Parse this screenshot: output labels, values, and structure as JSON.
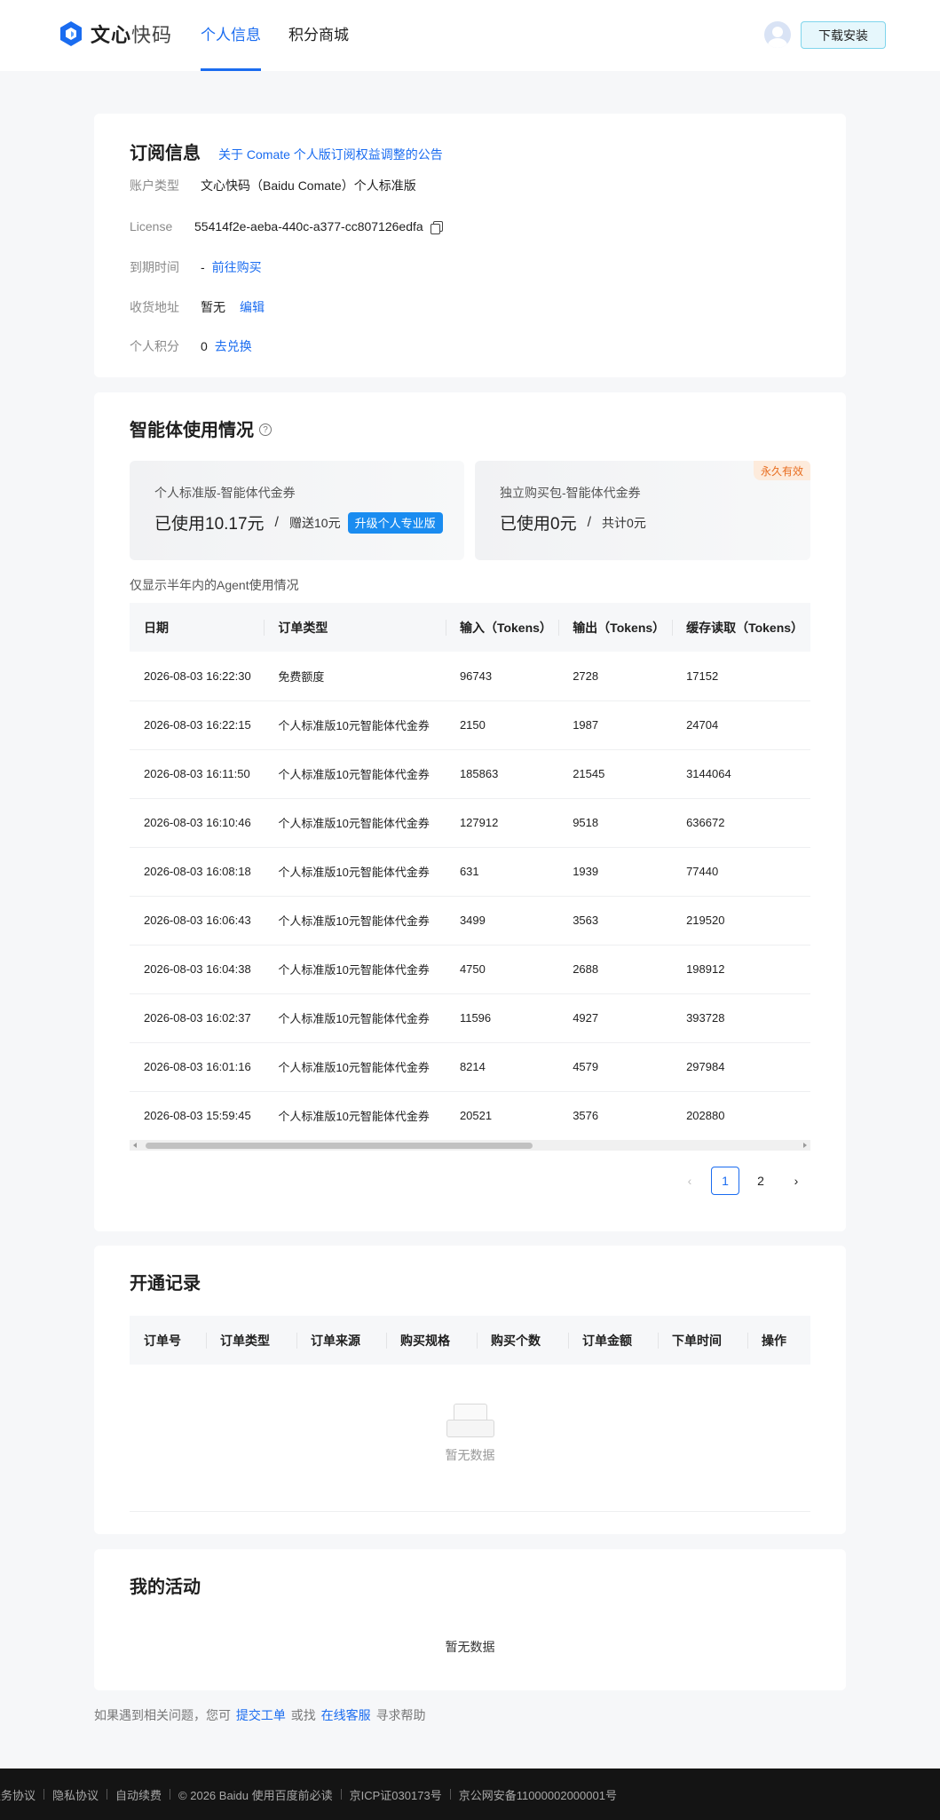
{
  "header": {
    "logo_brand": "文心",
    "logo_sub": "快码",
    "nav": [
      "个人信息",
      "积分商城"
    ],
    "download_label": "下载安装"
  },
  "subscription": {
    "title": "订阅信息",
    "announcement": "关于 Comate 个人版订阅权益调整的公告",
    "account_type_label": "账户类型",
    "account_type_value": "文心快码（Baidu Comate）个人标准版",
    "license_label": "License",
    "license_value": "55414f2e-aeba-440c-a377-cc807126edfa",
    "expire_label": "到期时间",
    "expire_value": "-",
    "expire_link": "前往购买",
    "address_label": "收货地址",
    "address_value": "暂无",
    "address_link": "编辑",
    "points_label": "个人积分",
    "points_value": "0",
    "points_link": "去兑换"
  },
  "agent": {
    "title": "智能体使用情况",
    "help_glyph": "?",
    "voucher1": {
      "title": "个人标准版-智能体代金券",
      "used": "已使用10.17元",
      "slash": "/",
      "gift": "赠送10元",
      "upgrade": "升级个人专业版"
    },
    "voucher2": {
      "title": "独立购买包-智能体代金券",
      "used": "已使用0元",
      "slash": "/",
      "total": "共计0元",
      "tag": "永久有效"
    },
    "note": "仅显示半年内的Agent使用情况",
    "columns": [
      "日期",
      "订单类型",
      "输入（Tokens）",
      "输出（Tokens）",
      "缓存读取（Tokens）"
    ],
    "rows": [
      [
        "2026-08-03 16:22:30",
        "免费额度",
        "96743",
        "2728",
        "17152"
      ],
      [
        "2026-08-03 16:22:15",
        "个人标准版10元智能体代金券",
        "2150",
        "1987",
        "24704"
      ],
      [
        "2026-08-03 16:11:50",
        "个人标准版10元智能体代金券",
        "185863",
        "21545",
        "3144064"
      ],
      [
        "2026-08-03 16:10:46",
        "个人标准版10元智能体代金券",
        "127912",
        "9518",
        "636672"
      ],
      [
        "2026-08-03 16:08:18",
        "个人标准版10元智能体代金券",
        "631",
        "1939",
        "77440"
      ],
      [
        "2026-08-03 16:06:43",
        "个人标准版10元智能体代金券",
        "3499",
        "3563",
        "219520"
      ],
      [
        "2026-08-03 16:04:38",
        "个人标准版10元智能体代金券",
        "4750",
        "2688",
        "198912"
      ],
      [
        "2026-08-03 16:02:37",
        "个人标准版10元智能体代金券",
        "11596",
        "4927",
        "393728"
      ],
      [
        "2026-08-03 16:01:16",
        "个人标准版10元智能体代金券",
        "8214",
        "4579",
        "297984"
      ],
      [
        "2026-08-03 15:59:45",
        "个人标准版10元智能体代金券",
        "20521",
        "3576",
        "202880"
      ]
    ],
    "pager": {
      "prev": "‹",
      "pages": [
        "1",
        "2"
      ],
      "current": "1",
      "next": "›"
    }
  },
  "open_records": {
    "title": "开通记录",
    "columns": [
      "订单号",
      "订单类型",
      "订单来源",
      "购买规格",
      "购买个数",
      "订单金额",
      "下单时间",
      "操作"
    ],
    "empty": "暂无数据"
  },
  "activities": {
    "title": "我的活动",
    "empty": "暂无数据"
  },
  "help": {
    "prefix": "如果遇到相关问题，您可",
    "ticket": "提交工单",
    "or": "或找",
    "service": "在线客服",
    "suffix": "寻求帮助"
  },
  "footer": [
    "服务协议",
    "隐私协议",
    "自动续费",
    "© 2026 Baidu 使用百度前必读",
    "京ICP证030173号",
    "京公网安备11000002000001号"
  ],
  "colors": {
    "accent": "#1a6cf0",
    "tag_orange": "#e86d1f",
    "footer_bg": "#141414"
  }
}
